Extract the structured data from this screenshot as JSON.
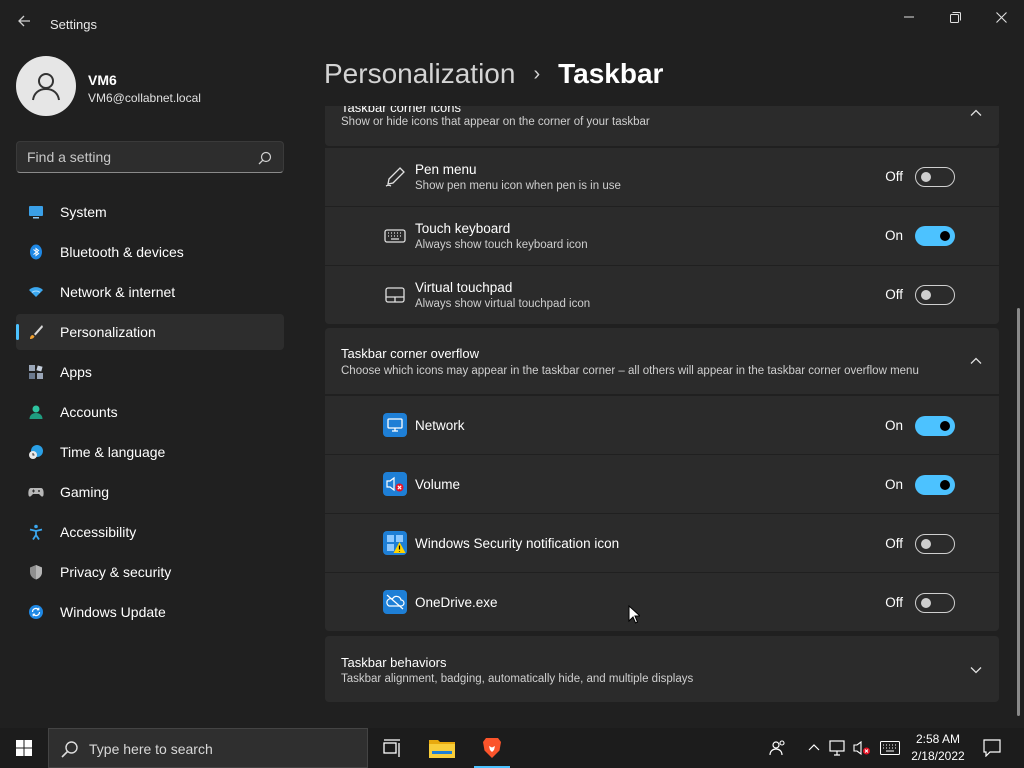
{
  "window": {
    "title": "Settings",
    "back_icon": "back-arrow-icon",
    "controls": [
      "minimize-icon",
      "maximize-icon",
      "close-icon"
    ]
  },
  "profile": {
    "name": "VM6",
    "email": "VM6@collabnet.local"
  },
  "search": {
    "placeholder": "Find a setting"
  },
  "sidebar": {
    "items": [
      {
        "label": "System",
        "icon": "system-icon"
      },
      {
        "label": "Bluetooth & devices",
        "icon": "bluetooth-icon"
      },
      {
        "label": "Network & internet",
        "icon": "wifi-icon"
      },
      {
        "label": "Personalization",
        "icon": "brush-icon",
        "active": true
      },
      {
        "label": "Apps",
        "icon": "apps-icon"
      },
      {
        "label": "Accounts",
        "icon": "accounts-icon"
      },
      {
        "label": "Time & language",
        "icon": "clock-globe-icon"
      },
      {
        "label": "Gaming",
        "icon": "gamepad-icon"
      },
      {
        "label": "Accessibility",
        "icon": "accessibility-icon"
      },
      {
        "label": "Privacy & security",
        "icon": "shield-icon"
      },
      {
        "label": "Windows Update",
        "icon": "update-icon"
      }
    ]
  },
  "header": {
    "parent": "Personalization",
    "separator": "›",
    "current": "Taskbar"
  },
  "corner_icons": {
    "title": "Taskbar corner icons",
    "subtitle": "Show or hide icons that appear on the corner of your taskbar",
    "expanded": true,
    "rows": [
      {
        "title": "Pen menu",
        "subtitle": "Show pen menu icon when pen is in use",
        "state": "Off",
        "on": false,
        "icon": "pen-icon"
      },
      {
        "title": "Touch keyboard",
        "subtitle": "Always show touch keyboard icon",
        "state": "On",
        "on": true,
        "icon": "keyboard-icon"
      },
      {
        "title": "Virtual touchpad",
        "subtitle": "Always show virtual touchpad icon",
        "state": "Off",
        "on": false,
        "icon": "touchpad-icon"
      }
    ]
  },
  "corner_overflow": {
    "title": "Taskbar corner overflow",
    "subtitle": "Choose which icons may appear in the taskbar corner – all others will appear in the taskbar corner overflow menu",
    "expanded": true,
    "rows": [
      {
        "title": "Network",
        "state": "On",
        "on": true,
        "icon": "network-monitor-icon"
      },
      {
        "title": "Volume",
        "state": "On",
        "on": true,
        "icon": "volume-muted-icon"
      },
      {
        "title": "Windows Security notification icon",
        "state": "Off",
        "on": false,
        "icon": "security-warning-icon"
      },
      {
        "title": "OneDrive.exe",
        "state": "Off",
        "on": false,
        "icon": "onedrive-icon"
      }
    ]
  },
  "behaviors": {
    "title": "Taskbar behaviors",
    "subtitle": "Taskbar alignment, badging, automatically hide, and multiple displays",
    "expanded": false
  },
  "taskbar": {
    "search_text": "Type here to search",
    "apps": [
      "task-view-icon",
      "file-explorer-icon",
      "brave-browser-icon"
    ],
    "tray": [
      "people-icon",
      "chevron-up-icon",
      "network-icon",
      "volume-muted-icon",
      "keyboard-icon"
    ],
    "time": "2:58 AM",
    "date": "2/18/2022",
    "notification_icon": "notification-icon"
  },
  "colors": {
    "accent": "#4cc2ff",
    "background": "#202020",
    "card": "#2b2b2b"
  }
}
